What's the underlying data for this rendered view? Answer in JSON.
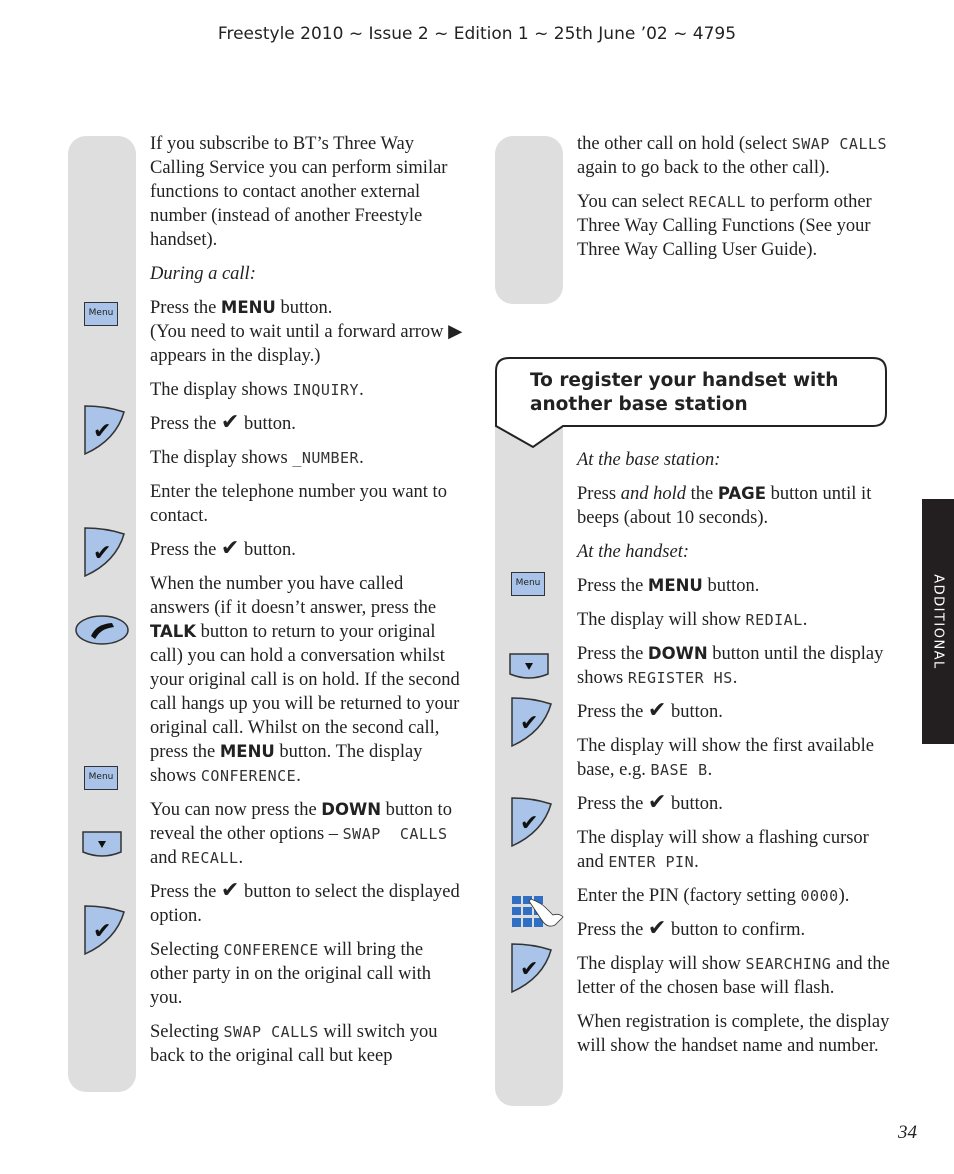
{
  "header": "Freestyle 2010 ~ Issue 2 ~ Edition 1 ~ 25th June ’02 ~ 4795",
  "side_tab": "ADDITIONAL",
  "page_number": "34",
  "icon_labels": {
    "menu": "Menu",
    "down": "▼",
    "tick": "✔"
  },
  "left": {
    "intro": "If you subscribe to BT’s Three Way Calling Service you can perform similar functions to contact another external number (instead of another Freestyle handset).",
    "during": "During a call:",
    "p1a": "Press the ",
    "p1b": "MENU",
    "p1c": " button.",
    "p1d": "(You need to wait until a forward arrow ▶ appears in the display.)",
    "p2a": "The display shows ",
    "p2b": "INQUIRY",
    "p2c": ".",
    "p3a": "Press the ",
    "p3c": " button.",
    "p4a": "The display shows ",
    "p4b": "_NUMBER",
    "p4c": ".",
    "p5": "Enter the telephone number you want to contact.",
    "p6a": "Press the ",
    "p6c": " button.",
    "p7a": "When the number you have called answers (if it doesn’t answer, press the ",
    "p7b": "TALK",
    "p7c": " button to return to your original call) you can hold a conversation whilst your original call is on hold. If the second call hangs up you will be returned to your original call. Whilst on the second call, press the ",
    "p7d": "MENU",
    "p7e": " button. The display shows ",
    "p7f": "CONFERENCE",
    "p7g": ".",
    "p8a": "You can now press the ",
    "p8b": "DOWN",
    "p8c": " button to reveal the other options – ",
    "p8d": "SWAP  CALLS",
    "p8e": " and ",
    "p8f": "RECALL",
    "p8g": ".",
    "p9a": "Press the ",
    "p9c": " button to select the displayed option.",
    "p10a": "Selecting ",
    "p10b": "CONFERENCE",
    "p10c": " will bring the other party in on the original call with you.",
    "p11a": "Selecting ",
    "p11b": "SWAP CALLS",
    "p11c": " will switch you back to the original call but keep"
  },
  "right": {
    "c1a": "the other call on hold (select ",
    "c1b": "SWAP CALLS",
    "c1c": " again to go back to the other call).",
    "c2a": "You can select ",
    "c2b": "RECALL",
    "c2c": " to perform other Three Way Calling Functions (See your Three Way Calling User Guide).",
    "section_title": "To register your handset with another base station",
    "base": "At the base station:",
    "r1a": "Press ",
    "r1b": "and hold",
    "r1c": " the ",
    "r1d": "PAGE",
    "r1e": " button until it beeps (about 10 seconds).",
    "handset": "At the handset:",
    "r2a": "Press the ",
    "r2b": "MENU",
    "r2c": " button.",
    "r3a": "The display will show ",
    "r3b": "REDIAL",
    "r3c": ".",
    "r4a": "Press the ",
    "r4b": "DOWN",
    "r4c": " button until the display shows ",
    "r4d": "REGISTER HS",
    "r4e": ".",
    "r5a": "Press the ",
    "r5c": " button.",
    "r6a": "The display will show the first available base, e.g. ",
    "r6b": "BASE B",
    "r6c": ".",
    "r7a": "Press the ",
    "r7c": " button.",
    "r8a": "The display will show a flashing cursor and ",
    "r8b": "ENTER PIN",
    "r8c": ".",
    "r9a": "Enter the PIN (factory setting ",
    "r9b": "0000",
    "r9c": ").",
    "r10a": "Press the ",
    "r10c": " button to confirm.",
    "r11a": "The display will show ",
    "r11b": "SEARCHING",
    "r11c": " and the letter of the chosen base will flash.",
    "r12": "When registration is complete, the display will show the handset name and number."
  }
}
